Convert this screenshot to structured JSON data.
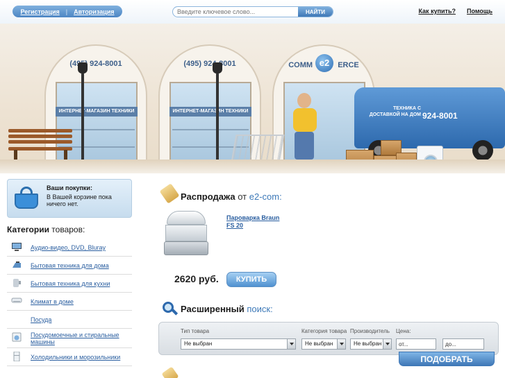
{
  "header": {
    "register_label": "Регистрация",
    "login_label": "Авторизация",
    "separator": "|",
    "search_placeholder": "Введите ключевое слово...",
    "search_button": "НАЙТИ",
    "how_to_buy": "Как купить?",
    "help": "Помощь"
  },
  "hero": {
    "phone_1": "(495) 924-8001",
    "phone_2": "(495) 924-8001",
    "sign_1": "ИНТЕРНЕТ-МАГАЗИН ТЕХНИКИ",
    "sign_2": "ИНТЕРНЕТ-МАГАЗИН ТЕХНИКИ",
    "logo_left": "COMM",
    "logo_mark": "e2",
    "logo_right": "ERCE",
    "van_text": "ТЕХНИКА С ДОСТАВКОЙ НА ДОМ",
    "van_phone": "924-8001"
  },
  "basket": {
    "title": "Ваши покупки:",
    "status": "В Вашей корзине пока ничего нет."
  },
  "categories": {
    "title_bold": "Категории",
    "title_rest": "товаров:",
    "items": [
      {
        "label": "Аудио-видео, DVD, Bluray",
        "icon": "tv-icon"
      },
      {
        "label": "Бытовая техника для дома",
        "icon": "iron-icon"
      },
      {
        "label": "Бытовая техника для кухни",
        "icon": "kitchen-appliance-icon"
      },
      {
        "label": "Климат в доме",
        "icon": "air-conditioner-icon"
      },
      {
        "label": "Посуда",
        "icon": "dishes-icon"
      },
      {
        "label": "Посудомоечные и стиральные машины",
        "icon": "washing-machine-icon"
      },
      {
        "label": "Холодильники и морозильники",
        "icon": "fridge-icon"
      }
    ]
  },
  "sale": {
    "title_bold": "Распродажа",
    "from": "от",
    "brand": "e2-com:",
    "product_name": "Пароварка Braun FS 20",
    "price": "2620 руб.",
    "buy_label": "КУПИТЬ"
  },
  "advanced_search": {
    "title_bold": "Расширенный",
    "title_rest": "поиск:",
    "type_label": "Тип товара",
    "category_label": "Категория товара",
    "maker_label": "Производитель",
    "price_label": "Цена:",
    "type_value": "Не выбран",
    "category_value": "Не выбран",
    "maker_value": "Не выбран",
    "price_from_value": "от...",
    "price_to_value": "до...",
    "submit_label": "ПОДОБРАТЬ"
  },
  "colors": {
    "accent_blue": "#3d79b8",
    "link_blue": "#2b5fa0",
    "button_blue": "#4f91d1"
  }
}
